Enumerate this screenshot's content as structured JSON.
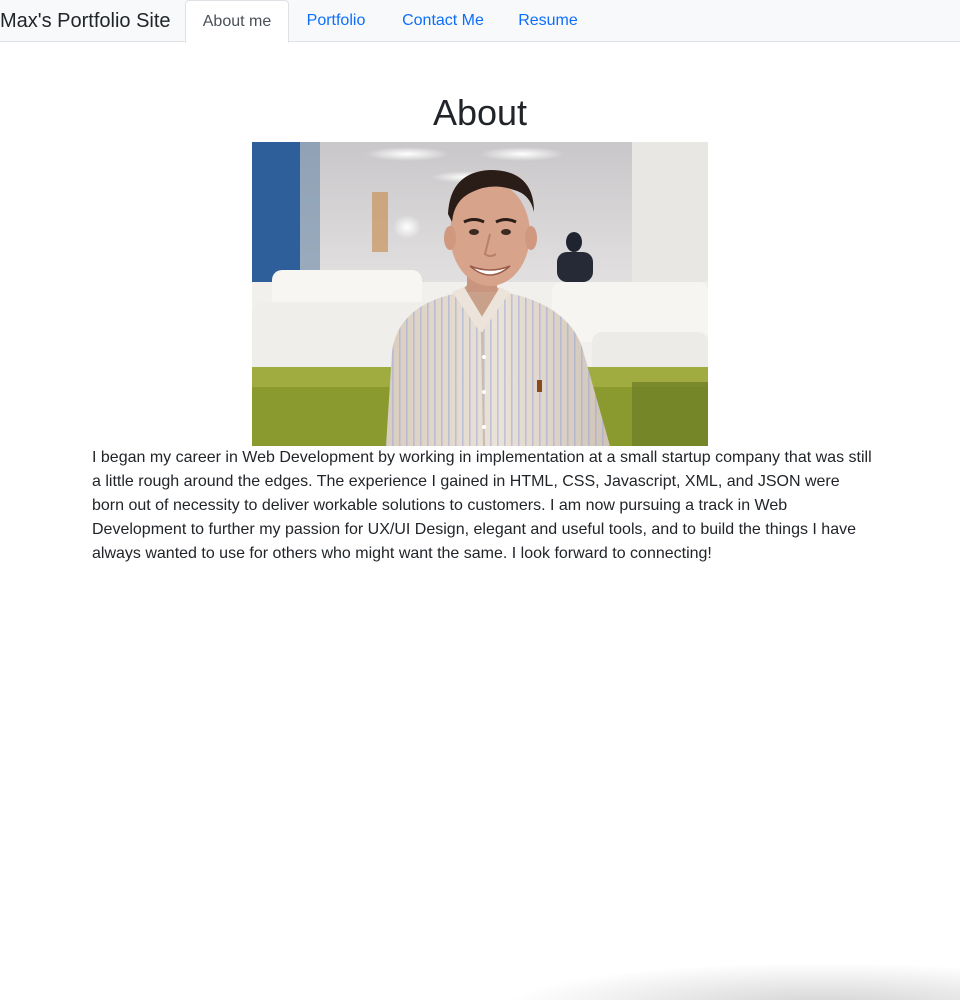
{
  "navbar": {
    "brand": "Max's Portfolio Site",
    "tabs": [
      {
        "label": "About me",
        "active": true
      },
      {
        "label": "Portfolio",
        "active": false
      },
      {
        "label": "Contact Me",
        "active": false
      },
      {
        "label": "Resume",
        "active": false
      }
    ]
  },
  "main": {
    "title": "About",
    "about_text": "I began my career in Web Development by working in implementation at a small startup company that was still a little rough around the edges. The experience I gained in HTML, CSS, Javascript, XML, and JSON were born out of necessity to deliver workable solutions to customers. I am now pursuing a track in Web Development to further my passion for UX/UI Design, elegant and useful tools, and to build the things I have always wanted to use for others who might want the same. I look forward to connecting!"
  },
  "colors": {
    "link": "#0d6efd",
    "navbar_bg": "#f8f9fa",
    "text": "#212529"
  }
}
